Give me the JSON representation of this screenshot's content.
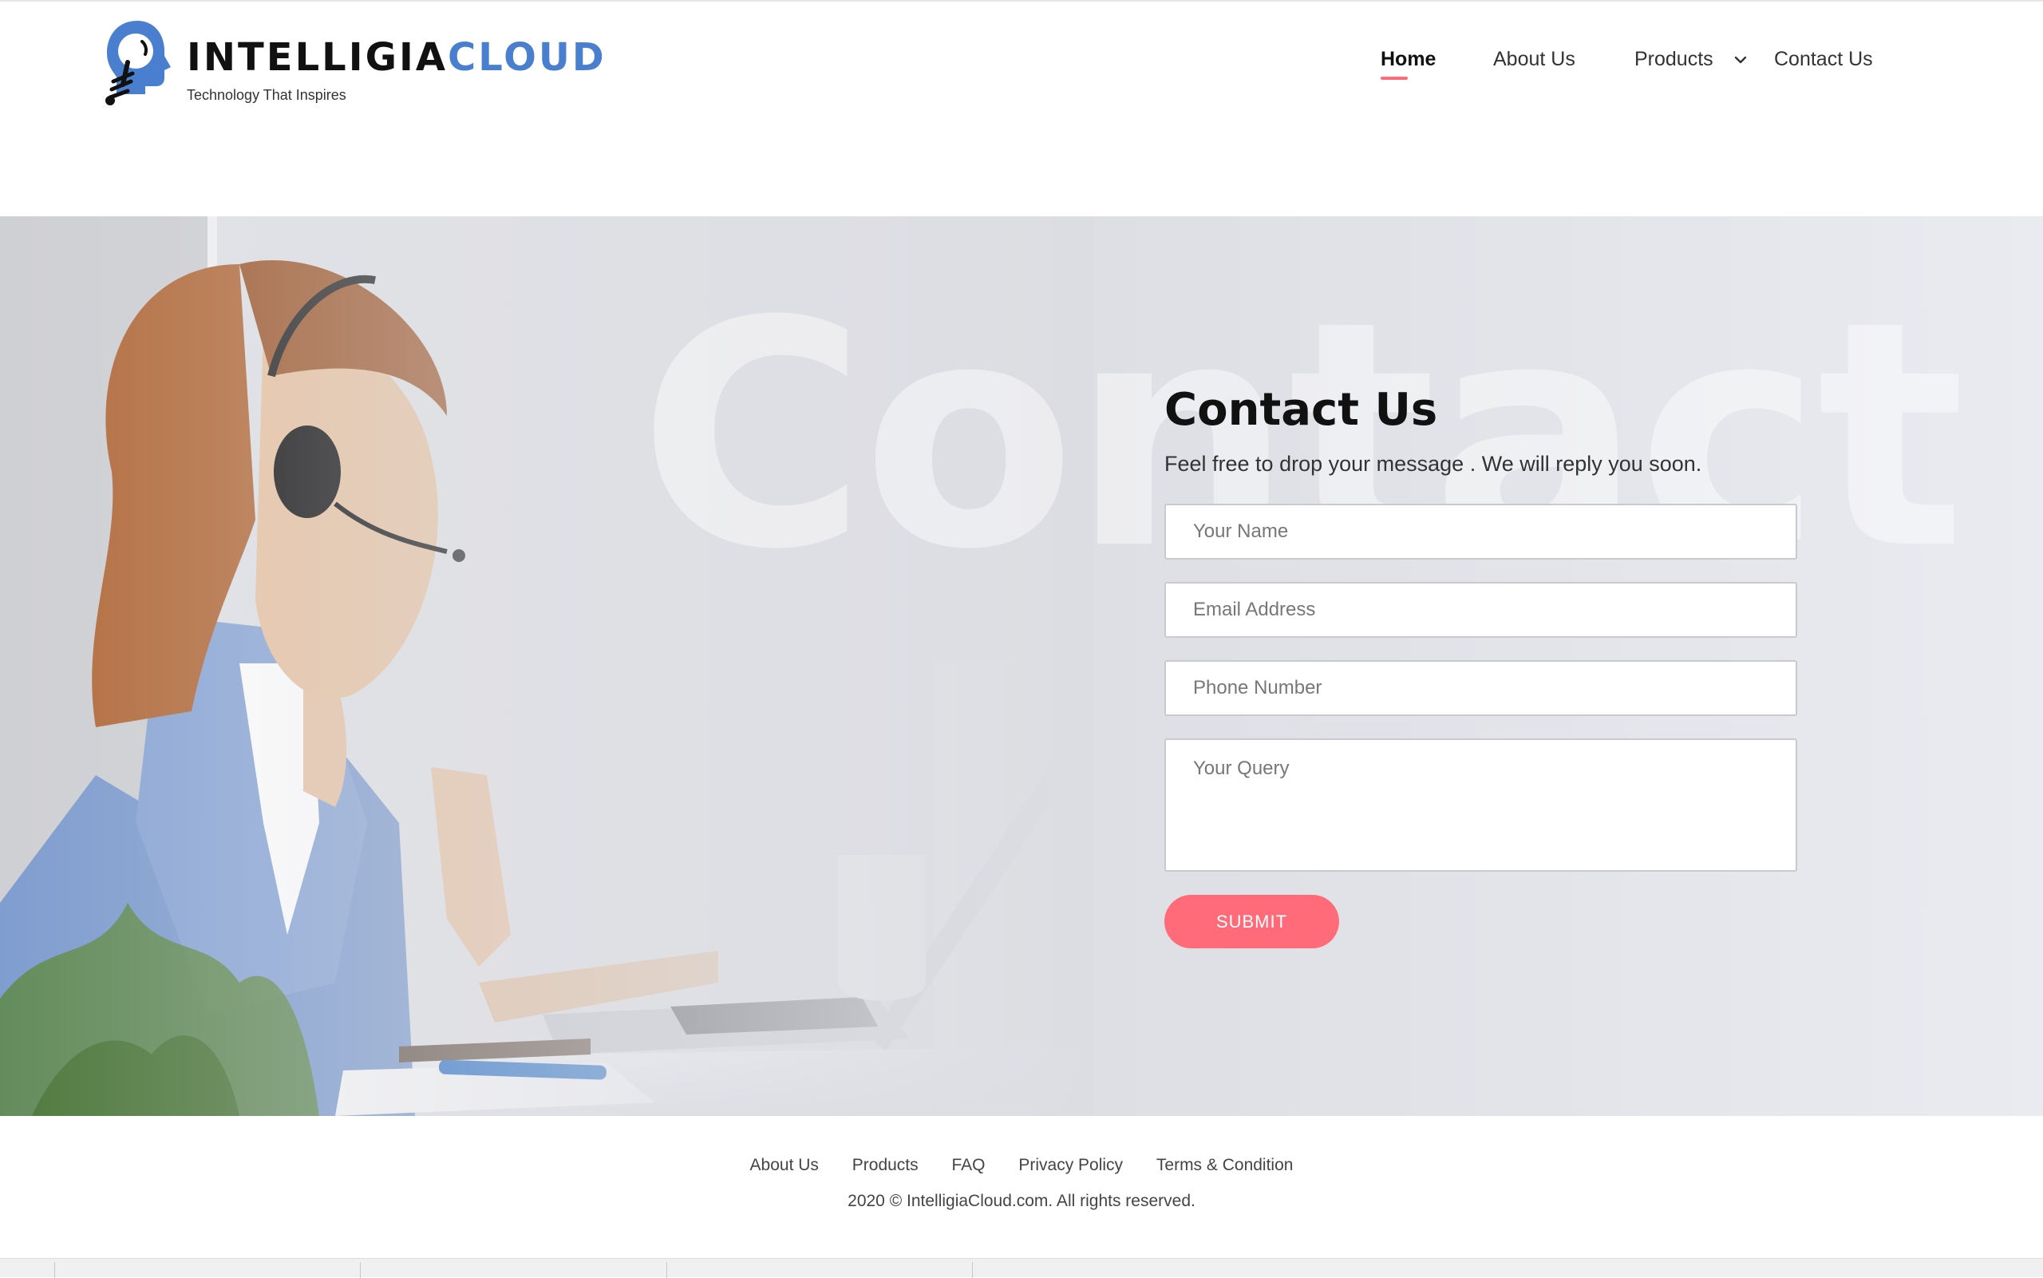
{
  "brand": {
    "name_part1": "INTELLIGIA",
    "name_part2": "CLOUD",
    "tagline": "Technology That Inspires",
    "colors": {
      "primary": "#4a7fcf",
      "dark": "#111111"
    }
  },
  "nav": {
    "items": [
      {
        "label": "Home",
        "active": true
      },
      {
        "label": "About Us"
      },
      {
        "label": "Products",
        "icon": "chevron-down-icon"
      },
      {
        "label": "Contact Us"
      }
    ],
    "accent_color": "#ff6b7a"
  },
  "hero": {
    "background_word": "Contact",
    "title": "Contact Us",
    "subtitle": "Feel free to drop your message . We will reply you soon.",
    "form": {
      "name_placeholder": "Your Name",
      "email_placeholder": "Email Address",
      "phone_placeholder": "Phone Number",
      "query_placeholder": "Your Query",
      "submit_label": "SUBMIT",
      "submit_color": "#ff6b78"
    }
  },
  "footer": {
    "links": [
      "About Us",
      "Products",
      "FAQ",
      "Privacy Policy",
      "Terms & Condition"
    ],
    "copyright": "2020 © IntelligiaCloud.com. All rights reserved."
  }
}
